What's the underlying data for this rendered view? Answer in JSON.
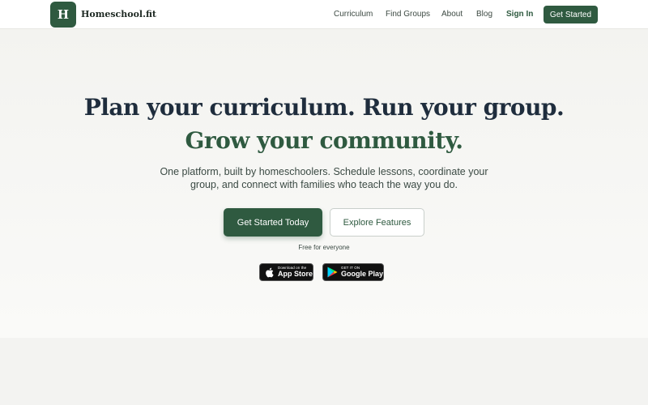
{
  "brand": {
    "logo_letter": "H",
    "name": "Homeschool.fit"
  },
  "nav": {
    "links": [
      "Curriculum",
      "Find Groups",
      "About",
      "Blog"
    ],
    "sign_in": "Sign In",
    "cta": "Get Started"
  },
  "hero": {
    "headline_main": "Plan your curriculum. Run your group. ",
    "headline_accent": "Grow your community.",
    "subtext": "One platform, built by homeschoolers. Schedule lessons, coordinate your group, and connect with families who teach the way you do.",
    "primary_button": "Get Started Today",
    "secondary_button": "Explore Features",
    "free_note": "Free for everyone"
  },
  "app_badges": {
    "apple": {
      "small": "Download on the",
      "big": "App Store",
      "icon": "apple-icon"
    },
    "google": {
      "small": "GET IT ON",
      "big": "Google Play",
      "icon": "google-play-icon"
    }
  },
  "colors": {
    "brand": "#2f5a40",
    "headline": "#1f2d3d",
    "background": "#f4f4f1"
  }
}
